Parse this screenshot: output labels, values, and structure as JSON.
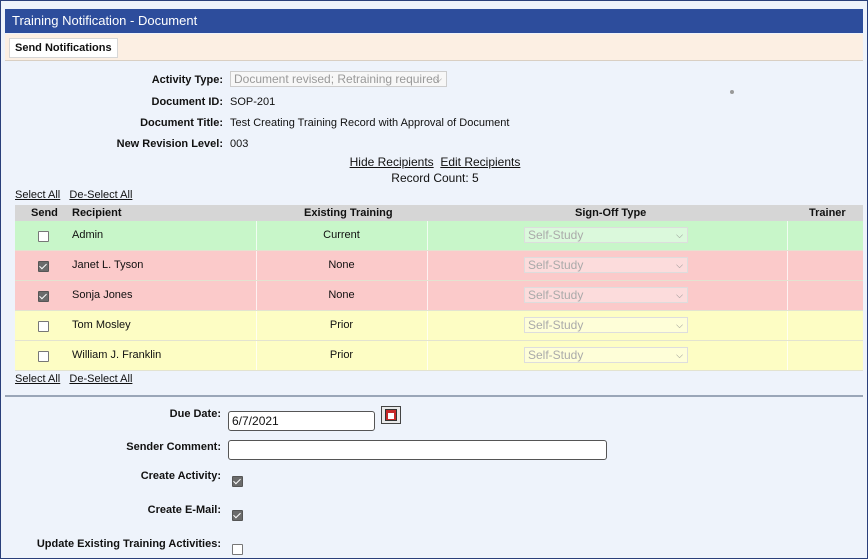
{
  "window": {
    "title": "Training Notification - Document"
  },
  "toolbar": {
    "send_label": "Send Notifications"
  },
  "details": {
    "activity_type_label": "Activity Type:",
    "activity_type_value": "Document revised; Retraining required",
    "document_id_label": "Document ID:",
    "document_id_value": "SOP-201",
    "document_title_label": "Document Title:",
    "document_title_value": "Test Creating Training Record with Approval of Document",
    "revision_label": "New Revision Level:",
    "revision_value": "003"
  },
  "recipients_links": {
    "hide": "Hide Recipients",
    "edit": "Edit Recipients",
    "record_count": "Record Count: 5"
  },
  "selection": {
    "select_all": "Select All",
    "deselect_all": "De-Select All"
  },
  "table": {
    "headers": {
      "send": "Send",
      "recipient": "Recipient",
      "existing": "Existing Training",
      "signoff": "Sign-Off Type",
      "trainer": "Trainer"
    },
    "rows": [
      {
        "recipient": "Admin",
        "existing": "Current",
        "signoff": "Self-Study",
        "checked": false,
        "status": "green"
      },
      {
        "recipient": "Janet L. Tyson",
        "existing": "None",
        "signoff": "Self-Study",
        "checked": true,
        "status": "red"
      },
      {
        "recipient": "Sonja Jones",
        "existing": "None",
        "signoff": "Self-Study",
        "checked": true,
        "status": "red"
      },
      {
        "recipient": "Tom Mosley",
        "existing": "Prior",
        "signoff": "Self-Study",
        "checked": false,
        "status": "yellow"
      },
      {
        "recipient": "William J. Franklin",
        "existing": "Prior",
        "signoff": "Self-Study",
        "checked": false,
        "status": "yellow"
      }
    ]
  },
  "bottom_form": {
    "due_date_label": "Due Date:",
    "due_date_value": "6/7/2021",
    "sender_comment_label": "Sender Comment:",
    "sender_comment_value": "",
    "create_activity_label": "Create Activity:",
    "create_activity_checked": true,
    "create_email_label": "Create E-Mail:",
    "create_email_checked": true,
    "update_existing_label": "Update Existing Training Activities:",
    "update_existing_checked": false
  },
  "colors": {
    "titlebar": "#2d4d9c",
    "current": "#c8f6c9",
    "none": "#fbcaca",
    "prior": "#fdfdc4"
  },
  "icons": {
    "calendar": "calendar-icon",
    "dropdown": "chevron-down-icon",
    "checkbox": "checkbox-icon"
  }
}
